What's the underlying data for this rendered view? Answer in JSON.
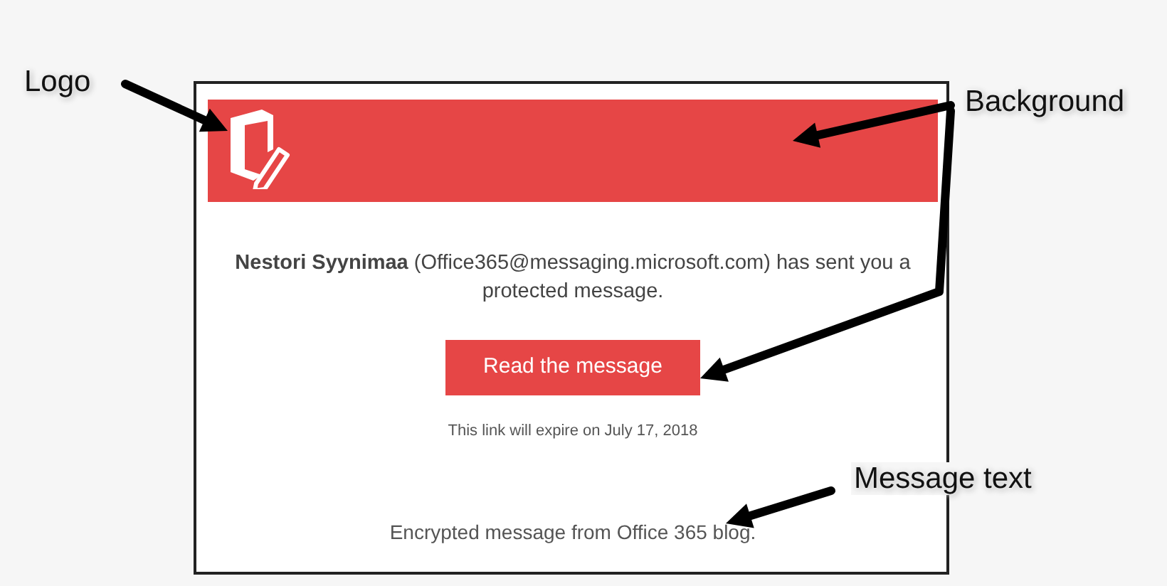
{
  "email": {
    "message": "**Nestori Syynimaa** (Office365@messaging.microsoft.com) has sent you a protected message.",
    "button": "Read the message",
    "expiry": "This link will expire on July 17, 2018",
    "footer": "Encrypted message from Office 365 blog."
  },
  "annotations": [
    {
      "label": "Logo"
    },
    {
      "label": "Background"
    },
    {
      "label": "Message text"
    }
  ]
}
